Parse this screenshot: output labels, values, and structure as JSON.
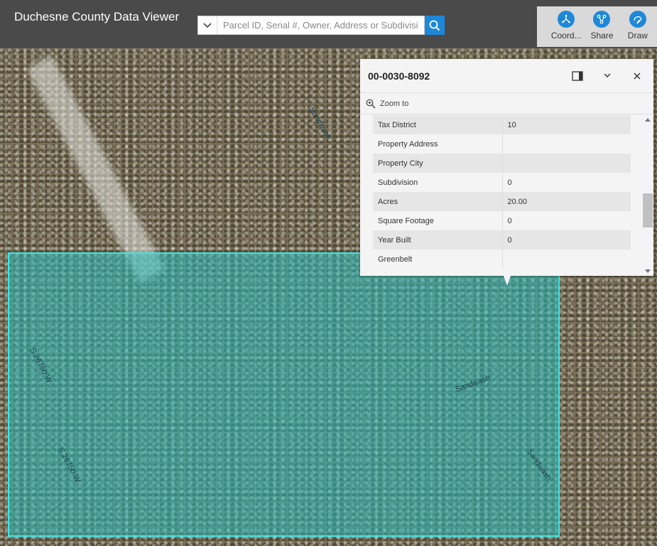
{
  "header": {
    "title": "Duchesne County Data Viewer",
    "search_placeholder": "Parcel ID, Serial #, Owner, Address or Subdivision"
  },
  "toolbar": {
    "items": [
      {
        "label": "Coord...",
        "icon": "coordinates-icon"
      },
      {
        "label": "Share",
        "icon": "share-icon"
      },
      {
        "label": "Draw",
        "icon": "draw-icon"
      }
    ]
  },
  "popup": {
    "title": "00-0030-8092",
    "zoom_label": "Zoom to",
    "attributes": [
      {
        "key": "Tax District",
        "value": "10"
      },
      {
        "key": "Property Address",
        "value": ""
      },
      {
        "key": "Property City",
        "value": ""
      },
      {
        "key": "Subdivision",
        "value": "0"
      },
      {
        "key": "Acres",
        "value": "20.00"
      },
      {
        "key": "Square Footage",
        "value": "0"
      },
      {
        "key": "Year Built",
        "value": "0"
      },
      {
        "key": "Greenbelt",
        "value": ""
      }
    ]
  },
  "map": {
    "labels": [
      "S 26750 W",
      "S 26750 W",
      "Sandwash",
      "Sandwash",
      "Sandwash"
    ]
  },
  "colors": {
    "header_bg": "#4a4a4a",
    "accent": "#1e88d8",
    "parcel_outline": "#3ee6e6"
  }
}
